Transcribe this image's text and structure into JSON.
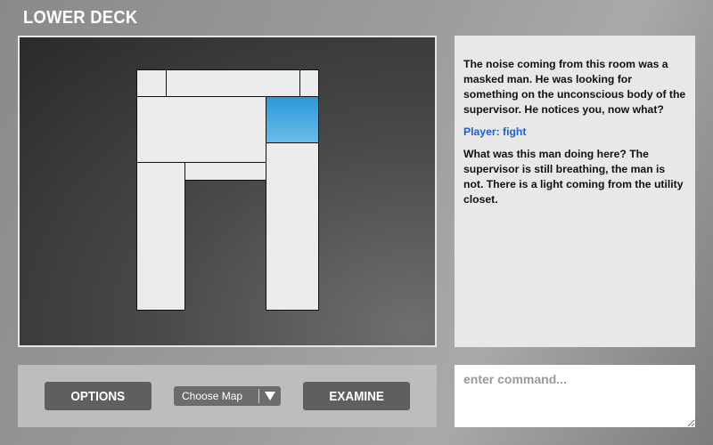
{
  "header": {
    "title": "LOWER DECK"
  },
  "map": {
    "active_color": "#3aa3dc",
    "room_color": "#ebebeb"
  },
  "log": {
    "entries": [
      {
        "type": "narration",
        "text": "The noise coming from this room was a masked man. He was looking for something on the unconscious body of the supervisor. He notices you, now what?"
      },
      {
        "type": "player",
        "text": "Player: fight"
      },
      {
        "type": "narration",
        "text": "What was this man doing here? The supervisor is still breathing, the man is not. There is a light coming from the utility closet."
      }
    ]
  },
  "controls": {
    "options_label": "OPTIONS",
    "map_select": {
      "selected": "Choose Map",
      "icon": "chevron-down-icon"
    },
    "examine_label": "EXAMINE"
  },
  "command": {
    "placeholder": "enter command..."
  }
}
